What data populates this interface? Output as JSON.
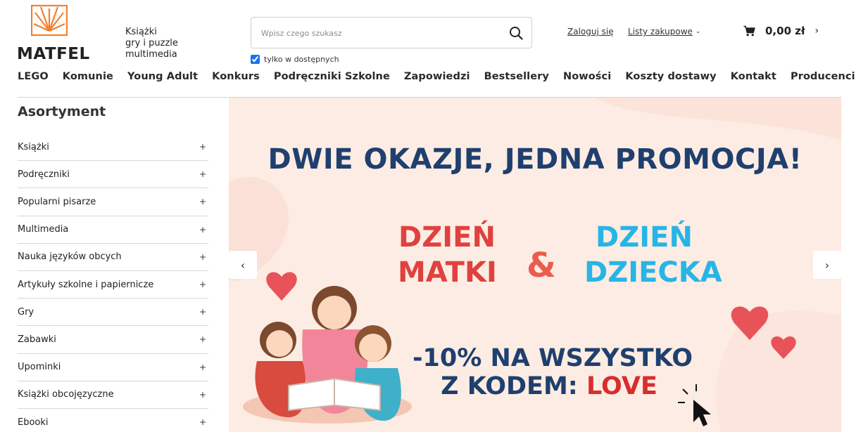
{
  "brand": {
    "name": "MATFEL",
    "tagline": [
      "Książki",
      "gry i puzzle",
      "multimedia"
    ],
    "accent": "#f47f2c"
  },
  "search": {
    "placeholder": "Wpisz czego szukasz",
    "value": "",
    "available_only_label": "tylko w dostępnych",
    "available_only_checked": true
  },
  "account": {
    "login_label": "Zaloguj się",
    "lists_label": "Listy zakupowe"
  },
  "cart": {
    "total": "0,00 zł"
  },
  "nav": {
    "items": [
      "LEGO",
      "Komunie",
      "Young Adult",
      "Konkurs",
      "Podręczniki Szkolne",
      "Zapowiedzi",
      "Bestsellery",
      "Nowości",
      "Koszty dostawy",
      "Kontakt",
      "Producenci"
    ]
  },
  "sidebar": {
    "title": "Asortyment",
    "items": [
      {
        "label": "Książki",
        "expand": "+"
      },
      {
        "label": "Podręczniki",
        "expand": "+"
      },
      {
        "label": "Popularni pisarze",
        "expand": "+"
      },
      {
        "label": "Multimedia",
        "expand": "+"
      },
      {
        "label": "Nauka języków obcych",
        "expand": "+"
      },
      {
        "label": "Artykuły szkolne i papiernicze",
        "expand": "+"
      },
      {
        "label": "Gry",
        "expand": "+"
      },
      {
        "label": "Zabawki",
        "expand": "+"
      },
      {
        "label": "Upominki",
        "expand": "+"
      },
      {
        "label": "Książki obcojęzyczne",
        "expand": "+"
      },
      {
        "label": "Ebooki",
        "expand": "+"
      }
    ]
  },
  "banner": {
    "headline": "DWIE OKAZJE, JEDNA PROMOCJA!",
    "left_line1": "DZIEŃ",
    "left_line2": "MATKI",
    "ampersand": "&",
    "right_line1": "DZIEŃ",
    "right_line2": "DZIECKA",
    "promo_line": "-10% NA WSZYSTKO",
    "code_prefix": "Z KODEM:",
    "code": "LOVE",
    "colors": {
      "navy": "#1f3f6e",
      "red": "#e0413f",
      "blue": "#27b5e6",
      "background": "#fdece3"
    }
  },
  "slider": {
    "prev_icon": "chevron-left-icon",
    "next_icon": "chevron-right-icon"
  }
}
